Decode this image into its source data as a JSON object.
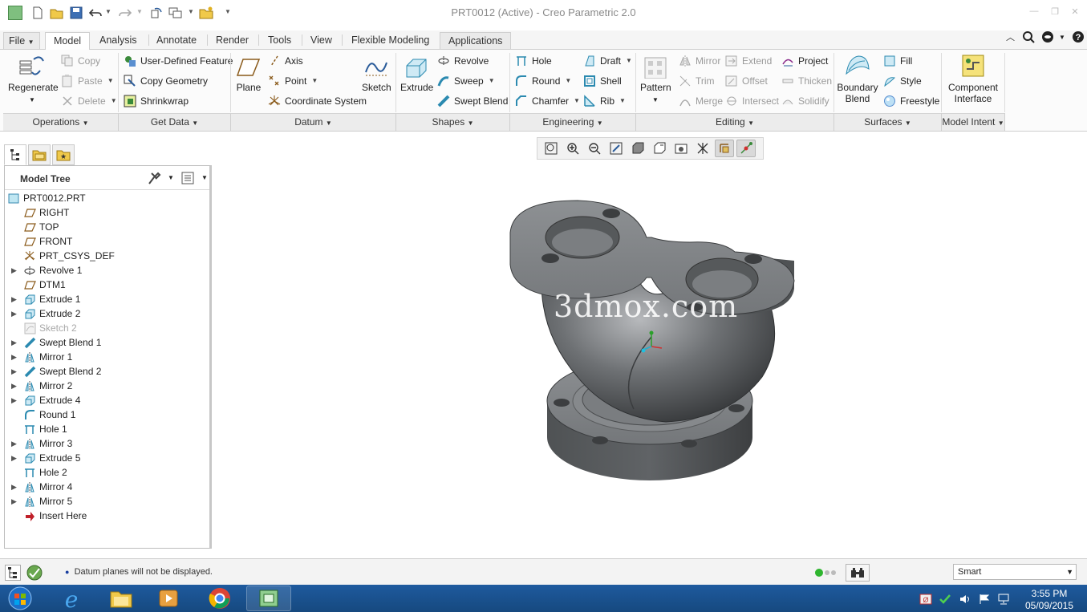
{
  "window": {
    "title": "PRT0012 (Active) - Creo Parametric 2.0"
  },
  "tabs": [
    "File",
    "Model",
    "Analysis",
    "Annotate",
    "Render",
    "Tools",
    "View",
    "Flexible Modeling",
    "Applications"
  ],
  "active_tab": "Model",
  "ribbon": {
    "operations": {
      "regenerate": "Regenerate",
      "copy": "Copy",
      "paste": "Paste",
      "delete": "Delete",
      "footer": "Operations"
    },
    "get_data": {
      "udf": "User-Defined Feature",
      "copy_geometry": "Copy Geometry",
      "shrinkwrap": "Shrinkwrap",
      "footer": "Get Data"
    },
    "datum": {
      "plane": "Plane",
      "axis": "Axis",
      "point": "Point",
      "csys": "Coordinate System",
      "sketch": "Sketch",
      "footer": "Datum"
    },
    "shapes": {
      "extrude": "Extrude",
      "revolve": "Revolve",
      "sweep": "Sweep",
      "swept_blend": "Swept Blend",
      "footer": "Shapes"
    },
    "engineering": {
      "hole": "Hole",
      "round": "Round",
      "chamfer": "Chamfer",
      "draft": "Draft",
      "shell": "Shell",
      "rib": "Rib",
      "footer": "Engineering"
    },
    "editing": {
      "pattern": "Pattern",
      "mirror": "Mirror",
      "trim": "Trim",
      "merge": "Merge",
      "extend": "Extend",
      "offset": "Offset",
      "intersect": "Intersect",
      "project": "Project",
      "thicken": "Thicken",
      "solidify": "Solidify",
      "footer": "Editing"
    },
    "surfaces": {
      "boundary_blend": "Boundary Blend",
      "fill": "Fill",
      "style": "Style",
      "freestyle": "Freestyle",
      "footer": "Surfaces"
    },
    "model_intent": {
      "component_interface": "Component Interface",
      "footer": "Model Intent"
    }
  },
  "model_tree": {
    "title": "Model Tree",
    "items": [
      {
        "label": "PRT0012.PRT",
        "icon": "part-icon",
        "expandable": false,
        "dim": false
      },
      {
        "label": "RIGHT",
        "icon": "datum-plane-icon",
        "expandable": false,
        "dim": false
      },
      {
        "label": "TOP",
        "icon": "datum-plane-icon",
        "expandable": false,
        "dim": false
      },
      {
        "label": "FRONT",
        "icon": "datum-plane-icon",
        "expandable": false,
        "dim": false
      },
      {
        "label": "PRT_CSYS_DEF",
        "icon": "csys-icon",
        "expandable": false,
        "dim": false
      },
      {
        "label": "Revolve 1",
        "icon": "revolve-icon",
        "expandable": true,
        "dim": false
      },
      {
        "label": "DTM1",
        "icon": "datum-plane-icon",
        "expandable": false,
        "dim": false
      },
      {
        "label": "Extrude 1",
        "icon": "extrude-icon",
        "expandable": true,
        "dim": false
      },
      {
        "label": "Extrude 2",
        "icon": "extrude-icon",
        "expandable": true,
        "dim": false
      },
      {
        "label": "Sketch 2",
        "icon": "sketch-icon",
        "expandable": false,
        "dim": true
      },
      {
        "label": "Swept Blend 1",
        "icon": "swept-blend-icon",
        "expandable": true,
        "dim": false
      },
      {
        "label": "Mirror 1",
        "icon": "mirror-icon",
        "expandable": true,
        "dim": false
      },
      {
        "label": "Swept Blend 2",
        "icon": "swept-blend-icon",
        "expandable": true,
        "dim": false
      },
      {
        "label": "Mirror 2",
        "icon": "mirror-icon",
        "expandable": true,
        "dim": false
      },
      {
        "label": "Extrude 4",
        "icon": "extrude-icon",
        "expandable": true,
        "dim": false
      },
      {
        "label": "Round 1",
        "icon": "round-icon",
        "expandable": false,
        "dim": false
      },
      {
        "label": "Hole 1",
        "icon": "hole-icon",
        "expandable": false,
        "dim": false
      },
      {
        "label": "Mirror 3",
        "icon": "mirror-icon",
        "expandable": true,
        "dim": false
      },
      {
        "label": "Extrude 5",
        "icon": "extrude-icon",
        "expandable": true,
        "dim": false
      },
      {
        "label": "Hole 2",
        "icon": "hole-icon",
        "expandable": false,
        "dim": false
      },
      {
        "label": "Mirror 4",
        "icon": "mirror-icon",
        "expandable": true,
        "dim": false
      },
      {
        "label": "Mirror 5",
        "icon": "mirror-icon",
        "expandable": true,
        "dim": false
      },
      {
        "label": "Insert Here",
        "icon": "insert-here-icon",
        "expandable": false,
        "dim": false
      }
    ]
  },
  "watermark": "3dmox.com",
  "status": {
    "message": "Datum planes will not be displayed.",
    "filter": "Smart"
  },
  "clock": {
    "time": "3:55 PM",
    "date": "05/09/2015"
  },
  "colors": {
    "accent": "#2b5c9a",
    "taskbar": "#1a5290",
    "model": "#6f7275"
  }
}
